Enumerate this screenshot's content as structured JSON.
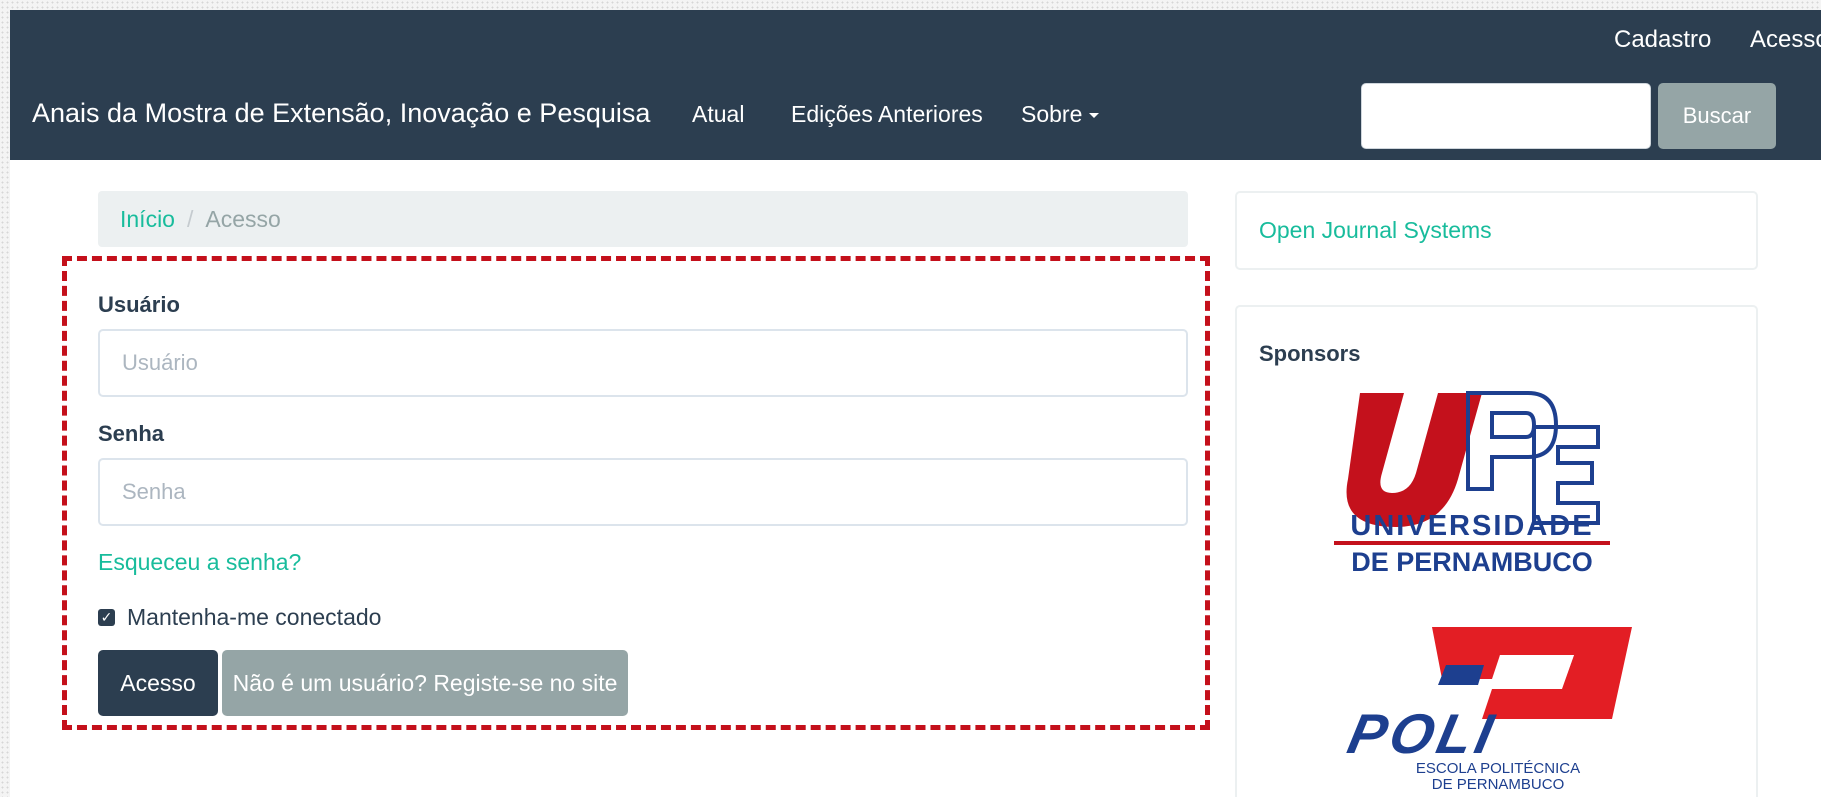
{
  "header": {
    "site_title": "Anais da Mostra de Extensão, Inovação e Pesquisa",
    "user_nav": {
      "register": "Cadastro",
      "login": "Acesso"
    },
    "nav": {
      "current": "Atual",
      "archives": "Edições Anteriores",
      "about": "Sobre"
    },
    "search": {
      "placeholder": "",
      "button": "Buscar"
    }
  },
  "breadcrumb": {
    "home": "Início",
    "separator": "/",
    "current": "Acesso"
  },
  "login_form": {
    "username_label": "Usuário",
    "username_placeholder": "Usuário",
    "password_label": "Senha",
    "password_placeholder": "Senha",
    "forgot_password": "Esqueceu a senha?",
    "remember_me": "Mantenha-me conectado",
    "remember_checked": true,
    "submit": "Acesso",
    "register": "Não é um usuário? Registe-se no site"
  },
  "sidebar": {
    "ojs_link": "Open Journal Systems",
    "sponsors_title": "Sponsors",
    "sponsors": [
      {
        "logo": "upe-logo",
        "text_line1": "UNIVERSIDADE",
        "text_line2": "DE PERNAMBUCO"
      },
      {
        "logo": "poli-logo",
        "wordmark": "POLI",
        "text_line1": "ESCOLA POLITÉCNICA",
        "text_line2": "DE PERNAMBUCO"
      }
    ]
  },
  "colors": {
    "header_bg": "#2c3e50",
    "accent_link": "#18bc9c",
    "secondary_button": "#95a5a6",
    "highlight_border": "#c4101b",
    "upe_red": "#c4111c",
    "upe_blue": "#1d3f8f"
  }
}
